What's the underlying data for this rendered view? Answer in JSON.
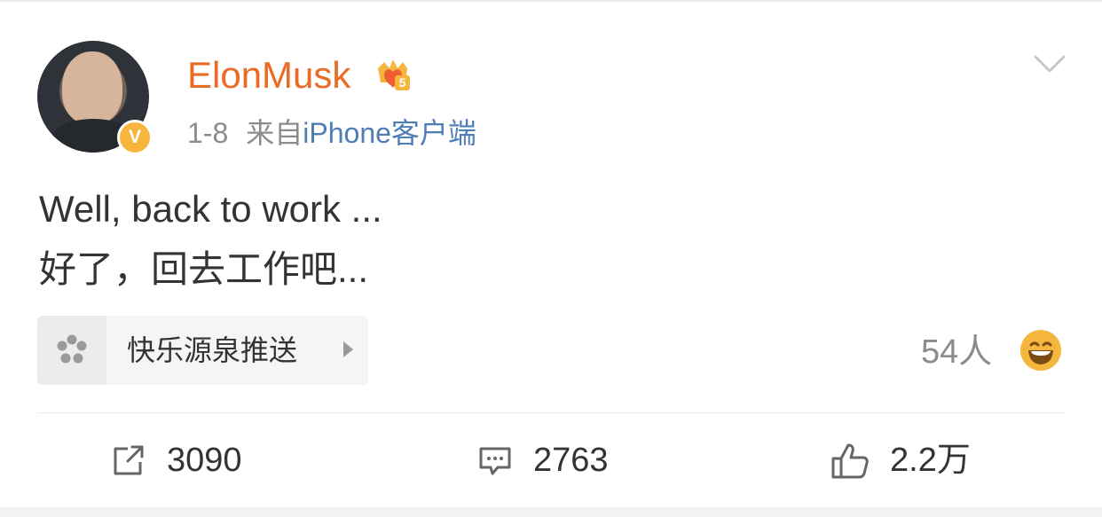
{
  "post": {
    "author": {
      "name": "ElonMusk",
      "avatar_icon": "user-avatar-photo",
      "verified_badge": "V",
      "membership_badge_icon": "crown-icon",
      "membership_badge_level": "5"
    },
    "meta": {
      "time": "1-8",
      "source_prefix": "来自",
      "source_name": "iPhone客户端"
    },
    "text_lines": [
      "Well, back to work ...",
      "好了，回去工作吧..."
    ],
    "promotion": {
      "icon": "flower-icon",
      "label": "快乐源泉推送"
    },
    "reaction": {
      "count": "54人",
      "icon": "grinning-emoji-icon"
    },
    "actions": {
      "forward": {
        "icon": "forward-icon",
        "count": "3090"
      },
      "comment": {
        "icon": "comment-icon",
        "count": "2763"
      },
      "like": {
        "icon": "thumb-up-icon",
        "count": "2.2万"
      }
    },
    "menu_icon": "chevron-down-icon"
  },
  "colors": {
    "username": "#e96b25",
    "source_link": "#4f7db5",
    "text": "#333333",
    "muted": "#8b8b8b",
    "verified": "#f6b63b",
    "emoji": "#f4b63d"
  }
}
